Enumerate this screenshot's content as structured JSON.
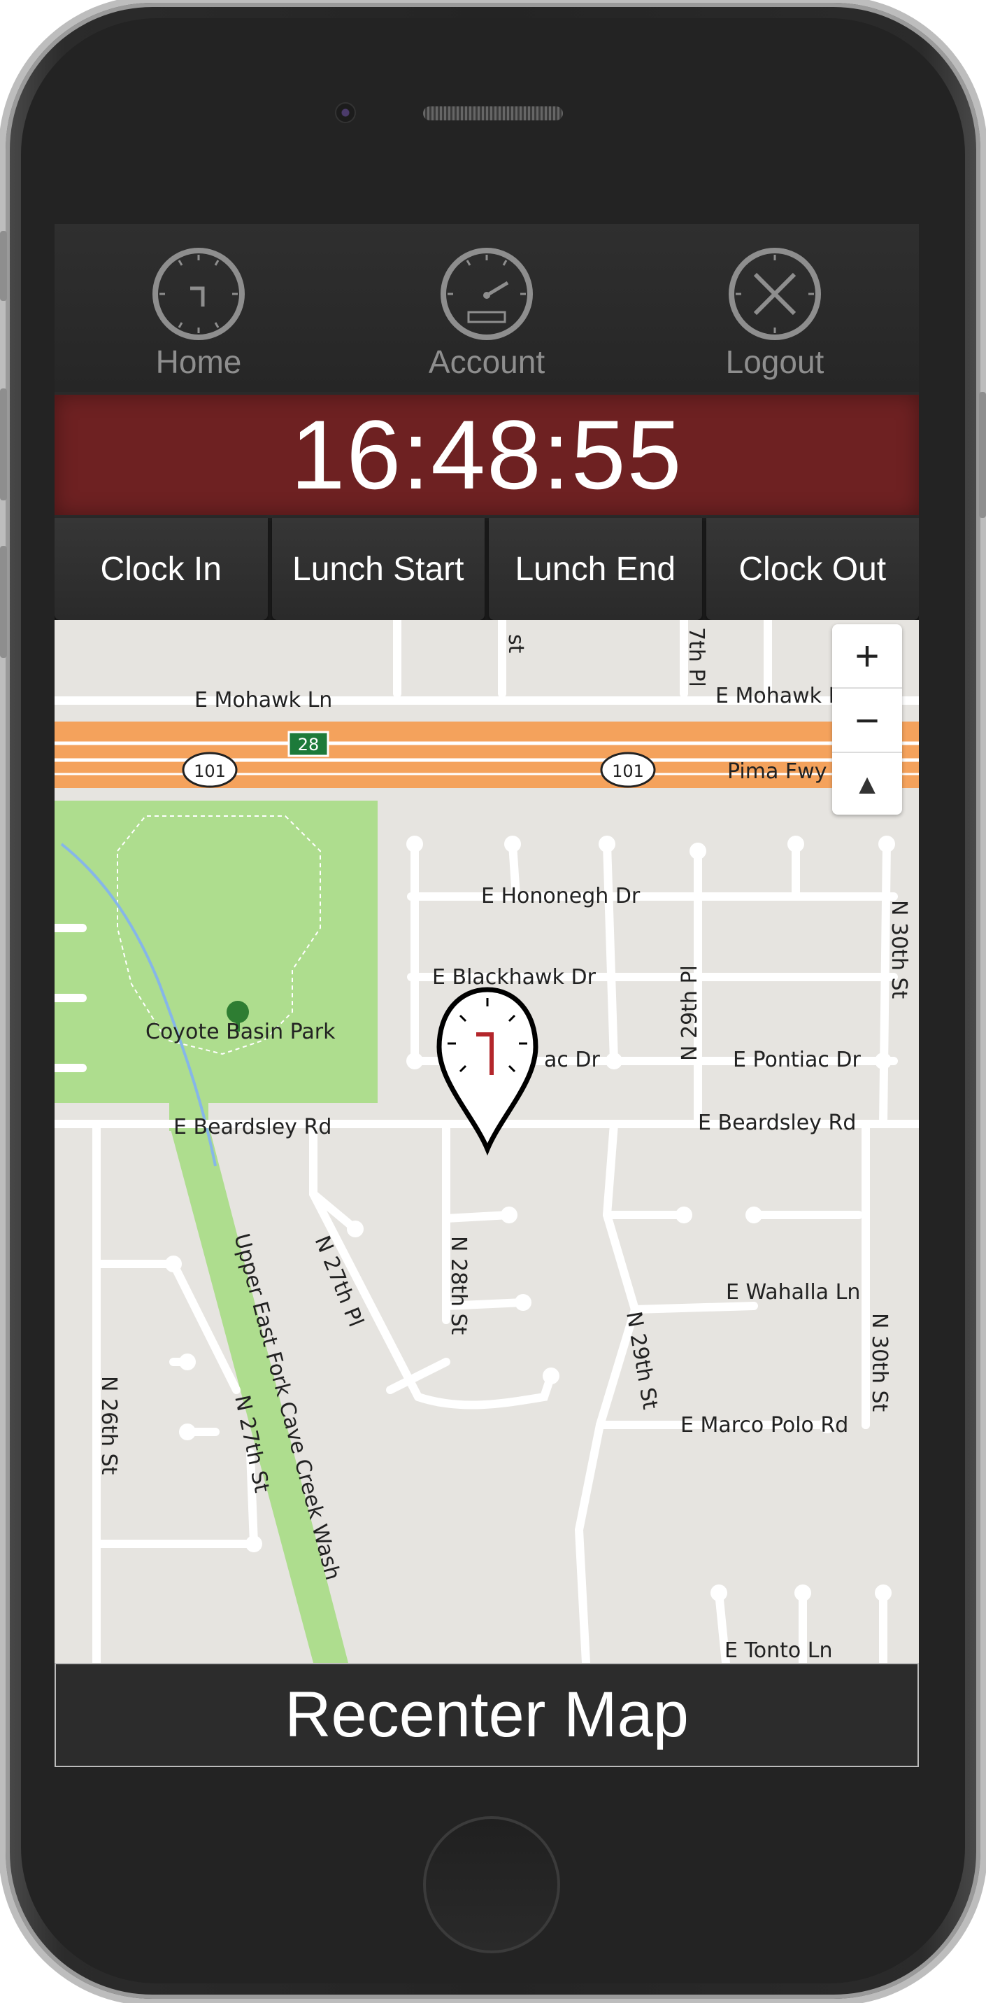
{
  "nav": {
    "items": [
      {
        "label": "Home",
        "icon": "clock-home-icon"
      },
      {
        "label": "Account",
        "icon": "gauge-account-icon"
      },
      {
        "label": "Logout",
        "icon": "close-logout-icon"
      }
    ]
  },
  "clock": {
    "time": "16:48:55"
  },
  "actions": {
    "clock_in": "Clock In",
    "lunch_start": "Lunch Start",
    "lunch_end": "Lunch End",
    "clock_out": "Clock Out"
  },
  "map": {
    "zoom_in": "+",
    "zoom_out": "−",
    "compass": "▲",
    "labels": {
      "mohawk_w": "E Mohawk Ln",
      "mohawk_e": "E Mohawk L",
      "pima": "Pima Fwy",
      "hwy101": "101",
      "hwy28": "28",
      "hononegh": "E Hononegh Dr",
      "blackhawk": "E Blackhawk Dr",
      "pontiac_w": "ac Dr",
      "pontiac_e": "E Pontiac Dr",
      "park": "Coyote Basin Park",
      "beardsley_w": "E Beardsley Rd",
      "beardsley_e": "E Beardsley Rd",
      "n29pl": "N 29th Pl",
      "n30st_n": "N 30th St",
      "n27pl": "N 27th Pl",
      "n28st": "N 28th St",
      "n29st": "N 29th St",
      "wahalla": "E Wahalla Ln",
      "n30st_s": "N 30th St",
      "marco": "E Marco Polo Rd",
      "n26st": "N 26th St",
      "n27st": "N 27th St",
      "wash": "Upper East Fork Cave Creek Wash",
      "tonto": "E Tonto Ln",
      "top_st": "st",
      "top_pl": "7th Pl"
    }
  },
  "recenter": {
    "label": "Recenter Map"
  },
  "colors": {
    "clock_bar": "#6e2122",
    "freeway": "#f5a05a",
    "park": "#aedd8e",
    "marker_accent": "#b3262b"
  }
}
